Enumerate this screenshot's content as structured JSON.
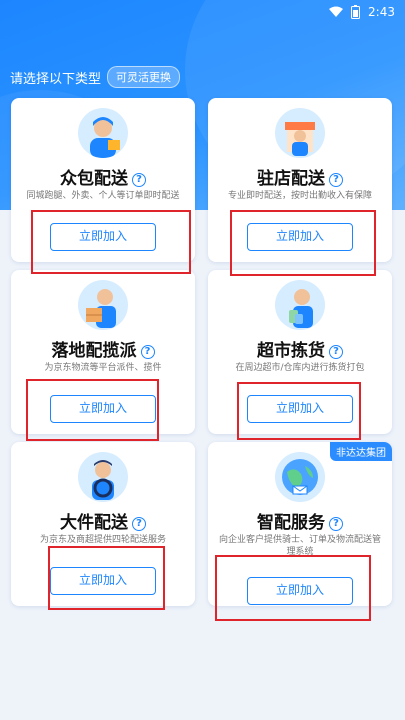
{
  "status": {
    "time": "2:43"
  },
  "header": {
    "prompt": "请选择以下类型",
    "tag": "可灵活更换"
  },
  "cards": [
    {
      "title": "众包配送",
      "desc": "同城跑腿、外卖、个人等订单即时配送",
      "button": "立即加入"
    },
    {
      "title": "驻店配送",
      "desc": "专业即时配送，按时出勤收入有保障",
      "button": "立即加入"
    },
    {
      "title": "落地配揽派",
      "desc": "为京东物流等平台派件、揽件",
      "button": "立即加入"
    },
    {
      "title": "超市拣货",
      "desc": "在周边超市/仓库内进行拣货打包",
      "button": "立即加入"
    },
    {
      "title": "大件配送",
      "desc": "为京东及商超提供四轮配送服务",
      "button": "立即加入"
    },
    {
      "title": "智配服务",
      "desc": "向企业客户提供骑士、订单及物流配送管理系统",
      "button": "立即加入",
      "badge": "非达达集团"
    }
  ],
  "colors": {
    "primary": "#1d86ff",
    "highlight": "#e0242b"
  }
}
